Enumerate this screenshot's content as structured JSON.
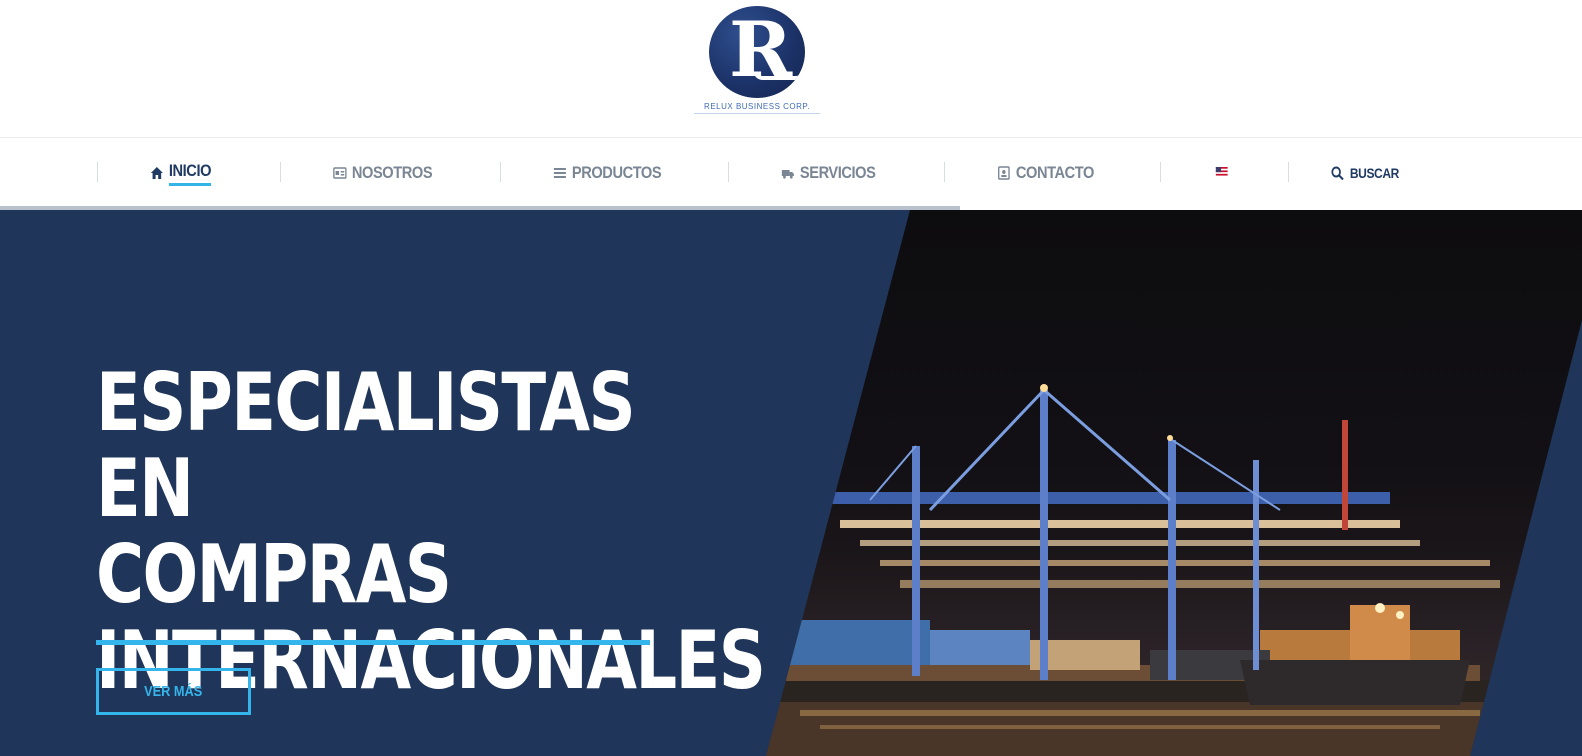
{
  "brand": {
    "logo_letter": "R",
    "logo_text": "RELUX BUSINESS CORP."
  },
  "nav": {
    "items": [
      {
        "label": "INICIO",
        "icon": "home-icon",
        "active": true
      },
      {
        "label": "NOSOTROS",
        "icon": "id-card-icon"
      },
      {
        "label": "PRODUCTOS",
        "icon": "list-icon"
      },
      {
        "label": "SERVICIOS",
        "icon": "truck-icon"
      },
      {
        "label": "CONTACTO",
        "icon": "contact-card-icon"
      },
      {
        "label": "",
        "icon": "us-flag-icon"
      },
      {
        "label": "BUSCAR",
        "icon": "search-icon"
      }
    ]
  },
  "hero": {
    "title_lines": [
      "ESPECIALISTAS EN",
      "COMPRAS",
      "INTERNACIONALES"
    ],
    "button_label": "VER MÁS",
    "image_alt": "night port cranes with container ships"
  },
  "colors": {
    "navy": "#1f3559",
    "accent": "#34b6ec",
    "nav_active": "#1f3a63",
    "nav_text": "#7a8694"
  }
}
